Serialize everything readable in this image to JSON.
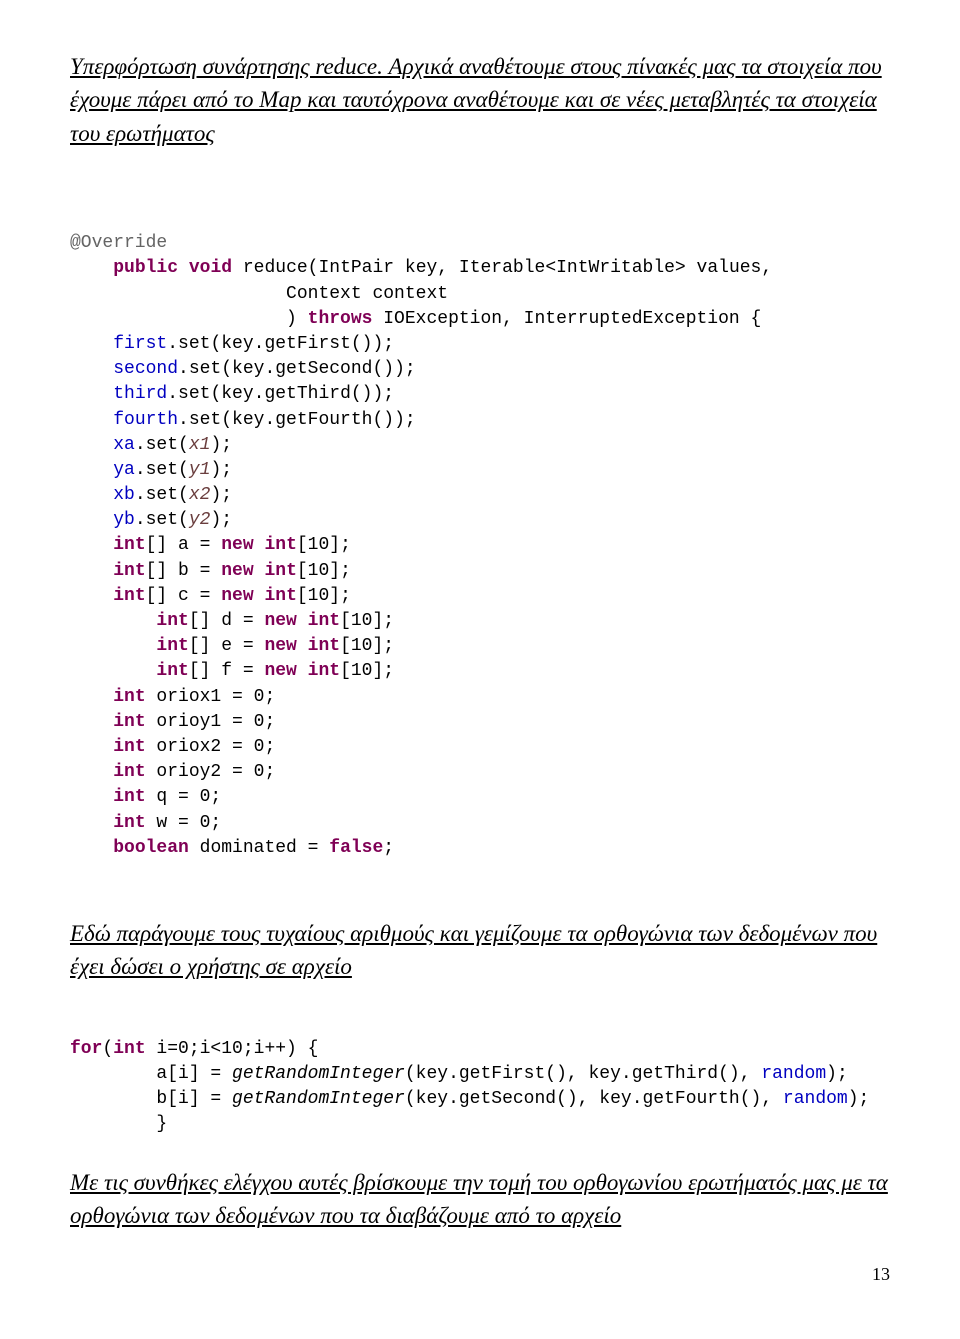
{
  "narr1": "Υπερφόρτωση συνάρτησης reduce. Αρχικά αναθέτουμε στους πίνακές μας τα στοιχεία που έχουμε πάρει από το Map και ταυτόχρονα αναθέτουμε και σε νέες μεταβλητές τα στοιχεία του ερωτήματος",
  "narr2": "Εδώ παράγουμε τους τυχαίους αριθμούς και γεμίζουμε τα ορθογώνια των δεδομένων που έχει δώσει ο χρήστης σε αρχείο",
  "narr3": "Με τις συνθήκες ελέγχου αυτές βρίσκουμε την τομή του ορθογωνίου ερωτήματός μας με τα ορθογώνια των δεδομένων που τα διαβάζουμε από το αρχείο",
  "c": {
    "ann": "@Override",
    "sig1a": "public",
    "sig1b": "void",
    "sig1c": " reduce(IntPair key, Iterable<IntWritable> values,",
    "sig2": "                    Context context",
    "sig3a": "                    ) ",
    "sig3b": "throws",
    "sig3c": " IOException, InterruptedException {",
    "l_first": "first",
    "getFirst": ".set(key.getFirst());",
    "l_second": "second",
    "getSecond": ".set(key.getSecond());",
    "l_third": "third",
    "getThird": ".set(key.getThird());",
    "l_fourth": "fourth",
    "getFourth": ".set(key.getFourth());",
    "xa": "xa",
    "x1": "x1",
    "setA": ".set(",
    "close": ");",
    "ya": "ya",
    "y1": "y1",
    "xb": "xb",
    "x2": "x2",
    "yb": "yb",
    "y2": "y2",
    "int": "int",
    "new": "new",
    "bool": "boolean",
    "false": "false",
    "arr_a": "[] a = ",
    "arr_b": "[] b = ",
    "arr_c": "[] c = ",
    "arr_d": "[] d = ",
    "arr_e": "[] e = ",
    "arr_f": "[] f = ",
    "newint10": "[10];",
    "oriox1": " oriox1 = 0;",
    "orioy1": " orioy1 = 0;",
    "oriox2": " oriox2 = 0;",
    "orioy2": " orioy2 = 0;",
    "q0": " q = 0;",
    "w0": " w = 0;",
    "dom": " dominated = ",
    "for": "for",
    "forhead": "(",
    "for_i": " i=0;i<10;i++) {",
    "ai": "        a[i] = ",
    "bi": "        b[i] = ",
    "gri": "getRandomInteger",
    "gri_a_args": "(key.getFirst(), key.getThird(), ",
    "gri_b_args": "(key.getSecond(), key.getFourth(), ",
    "random": "random",
    "close2": ");",
    "rbrace": "        }"
  },
  "page": "13"
}
